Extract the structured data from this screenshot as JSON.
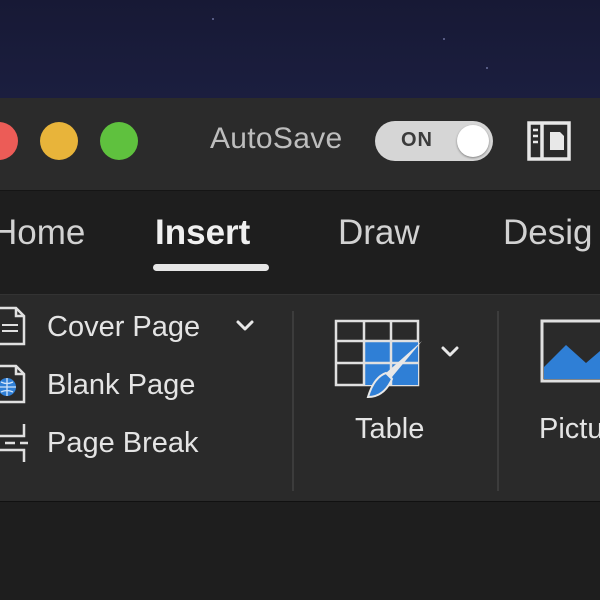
{
  "titlebar": {
    "autosave_label": "AutoSave",
    "autosave_state": "ON",
    "autosave_on": true
  },
  "tabs": [
    {
      "label": "Home",
      "visible_text": "Home",
      "active": false
    },
    {
      "label": "Insert",
      "visible_text": "Insert",
      "active": true
    },
    {
      "label": "Draw",
      "visible_text": "Draw",
      "active": false
    },
    {
      "label": "Design",
      "visible_text": "Desig",
      "active": false
    }
  ],
  "ribbon": {
    "pages": {
      "items": [
        {
          "label": "Cover Page",
          "icon": "cover-page-icon",
          "has_dropdown": true
        },
        {
          "label": "Blank Page",
          "icon": "blank-page-icon",
          "has_dropdown": false
        },
        {
          "label": "Page Break",
          "icon": "page-break-icon",
          "has_dropdown": false
        }
      ]
    },
    "table": {
      "label": "Table",
      "icon": "table-icon",
      "has_dropdown": true
    },
    "picture": {
      "label": "Pictures",
      "visible_text": "Pictu",
      "icon": "picture-icon"
    }
  },
  "colors": {
    "close": "#ec5c57",
    "minimize": "#e8b43a",
    "zoom": "#5fc13e",
    "accent_blue": "#2f7fd6"
  }
}
